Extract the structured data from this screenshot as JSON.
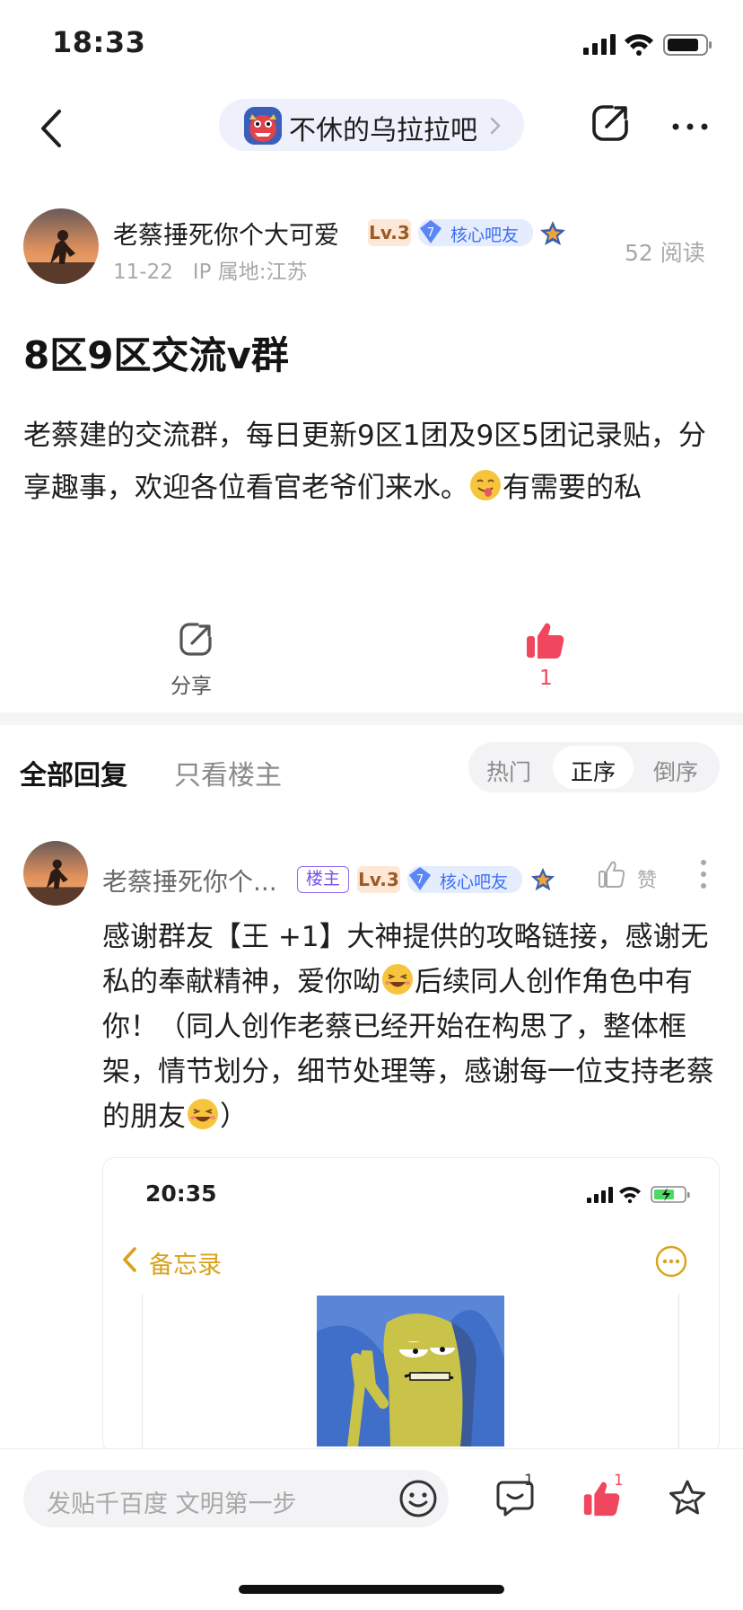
{
  "status_bar": {
    "time": "18:33",
    "battery_level": 0.85
  },
  "nav": {
    "forum_name": "不休的乌拉拉吧",
    "icons": {
      "back": "chevron-left-icon",
      "share": "share-icon",
      "more": "more-horizontal-icon"
    }
  },
  "author": {
    "name": "老蔡捶死你个大可爱",
    "level": "Lv.3",
    "fan_level": "7",
    "fan_title": "核心吧友",
    "date": "11-22",
    "ip": "IP 属地:江苏",
    "read_count": "52 阅读"
  },
  "post": {
    "title": "8区9区交流v群",
    "body_before_emoji": "老蔡建的交流群，每日更新9区1团及9区5团记录贴，分享趣事，欢迎各位看官老爷们来水。",
    "body_after_emoji": "有需要的私"
  },
  "actions": {
    "share_label": "分享",
    "like_count": "1"
  },
  "tabs": {
    "all": "全部回复",
    "owner_only": "只看楼主"
  },
  "sort": {
    "hot": "热门",
    "asc": "正序",
    "desc": "倒序"
  },
  "reply": {
    "name": "老蔡捶死你个...",
    "op_badge": "楼主",
    "level": "Lv.3",
    "fan_level": "7",
    "fan_title": "核心吧友",
    "like_label": "赞",
    "body_part1": "感谢群友【王 +1】大神提供的攻略链接，感谢无私的奉献精神，爱你呦",
    "body_part2": "后续同人创作角色中有你！（同人创作老蔡已经开始在构思了，整体框架，情节划分，细节处理等，感谢每一位支持老蔡的朋友",
    "body_part3": "）"
  },
  "embedded_screenshot": {
    "time": "20:35",
    "back_label": "备忘录"
  },
  "bottom_bar": {
    "input_placeholder": "发贴千百度 文明第一步",
    "comment_count": "1",
    "like_count": "1"
  },
  "colors": {
    "like_red": "#f0475e",
    "memo_gold": "#d9a21b",
    "core_blue": "#3d6ff2",
    "op_purple": "#7453e8"
  }
}
